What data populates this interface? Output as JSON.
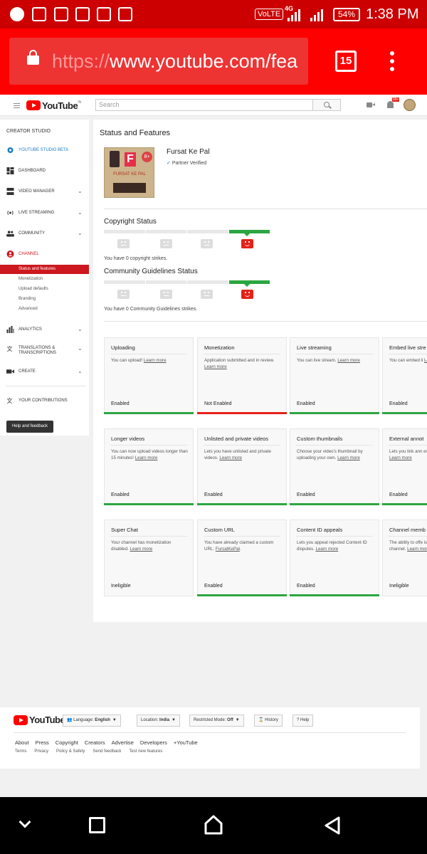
{
  "status_bar": {
    "volte": "VoLTE",
    "network": "4G",
    "battery": "54%",
    "time": "1:38 PM",
    "notification_icons": [
      "news-icon",
      "gmail-icon",
      "gmail-icon",
      "shirt-icon",
      "image-icon",
      "pulse-icon"
    ]
  },
  "browser": {
    "url_scheme": "https://",
    "url_rest": "www.youtube.com/fea",
    "tab_count": "15"
  },
  "yt_header": {
    "logo_text": "YouTube",
    "logo_sup": "IN",
    "search_placeholder": "Search",
    "notification_badge": "99+"
  },
  "sidebar": {
    "title": "CREATOR STUDIO",
    "items": [
      {
        "label": "YOUTUBE STUDIO BETA"
      },
      {
        "label": "DASHBOARD"
      },
      {
        "label": "VIDEO MANAGER"
      },
      {
        "label": "LIVE STREAMING"
      },
      {
        "label": "COMMUNITY"
      },
      {
        "label": "CHANNEL"
      },
      {
        "label": "ANALYTICS"
      },
      {
        "label": "TRANSLATIONS &"
      },
      {
        "label": "CREATE"
      },
      {
        "label": "YOUR CONTRIBUTIONS"
      }
    ],
    "translations_line2": "TRANSCRIPTIONS",
    "channel_sub": [
      "Status and features",
      "Monetization",
      "Upload defaults",
      "Branding",
      "Advanced"
    ],
    "help_button": "Help and feedback"
  },
  "main": {
    "title": "Status and Features",
    "channel_name": "Fursat Ke Pal",
    "partner_status": "Partner Verified",
    "thumb_text": "FURSAT KE PAL",
    "thumb_letter": "F",
    "thumb_badge": "8+",
    "copyright_title": "Copyright Status",
    "copyright_note": "You have 0 copyright strikes.",
    "guidelines_title": "Community Guidelines Status",
    "guidelines_note": "You have 0 Community Guidelines strikes.",
    "learn_more": "Learn more",
    "cards": [
      {
        "title": "Uploading",
        "desc": "You can upload!",
        "status": "Enabled",
        "bar": "green"
      },
      {
        "title": "Monetization",
        "desc": "Application submitted and in review.",
        "status": "Not Enabled",
        "bar": "red"
      },
      {
        "title": "Live streaming",
        "desc": "You can live stream.",
        "status": "Enabled",
        "bar": "green"
      },
      {
        "title": "Embed live stre",
        "desc": "You can embed li",
        "status": "Enabled",
        "bar": "green"
      },
      {
        "title": "Longer videos",
        "desc": "You can now upload videos longer than 15 minutes!",
        "status": "Enabled",
        "bar": "green"
      },
      {
        "title": "Unlisted and private videos",
        "desc": "Lets you have unlisted and private videos.",
        "status": "Enabled",
        "bar": "green"
      },
      {
        "title": "Custom thumbnails",
        "desc": "Choose your video's thumbnail by uploading your own.",
        "status": "Enabled",
        "bar": "green"
      },
      {
        "title": "External annot",
        "desc": "Lets you link ann external sites or r",
        "status": "Enabled",
        "bar": "green"
      },
      {
        "title": "Super Chat",
        "desc": "Your channel has monetization disabled.",
        "status": "Ineligible",
        "bar": "none"
      },
      {
        "title": "Custom URL",
        "desc": "You have already claimed a custom URL:",
        "link": "FursatKePal",
        "status": "Enabled",
        "bar": "green"
      },
      {
        "title": "Content ID appeals",
        "desc": "Lets you appeal rejected Content ID disputes.",
        "status": "Enabled",
        "bar": "green"
      },
      {
        "title": "Channel memb",
        "desc": "The ability to offe isn't yet available channel.",
        "status": "Ineligible",
        "bar": "none"
      }
    ]
  },
  "footer": {
    "logo_text": "YouTube",
    "language_label": "Language:",
    "language_value": "English",
    "location_label": "Location:",
    "location_value": "India",
    "restricted_label": "Restricted Mode:",
    "restricted_value": "Off",
    "history": "History",
    "help": "Help",
    "links_primary": [
      "About",
      "Press",
      "Copyright",
      "Creators",
      "Advertise",
      "Developers",
      "+YouTube"
    ],
    "links_secondary": [
      "Terms",
      "Privacy",
      "Policy & Safety",
      "Send feedback",
      "Test new features"
    ]
  },
  "colors": {
    "status_bar": "#cc0000",
    "browser_bar": "#ff0000",
    "enabled": "#2ba640",
    "not_enabled": "#e62117",
    "accent_blue": "#167ac6"
  }
}
